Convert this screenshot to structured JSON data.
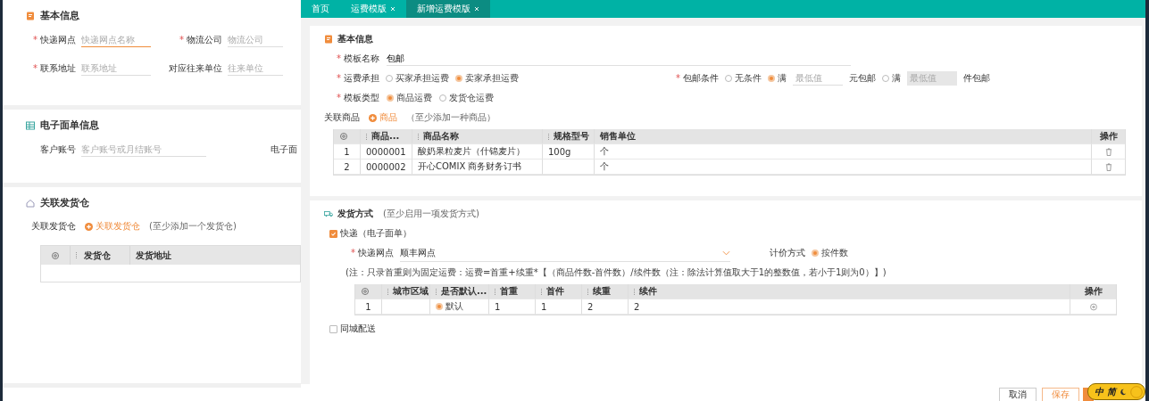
{
  "background_page": {
    "basic_info": {
      "title": "基本信息",
      "fields": [
        {
          "label": "快递网点",
          "required_mark": "*",
          "placeholder": "快递网点名称",
          "focused": true
        },
        {
          "label": "物流公司",
          "required_mark": "*",
          "placeholder": "物流公司",
          "focused": false
        },
        {
          "label": "联系地址",
          "required_mark": "*",
          "placeholder": "联系地址",
          "focused": false
        },
        {
          "label": "对应往来单位",
          "placeholder": "往来单位",
          "focused": false
        }
      ]
    },
    "e_waybill": {
      "title": "电子面单信息",
      "account": {
        "label": "客户账号",
        "placeholder": "客户账号或月结账号"
      },
      "column_2_label": "电子面"
    },
    "warehouse": {
      "title": "关联发货仓",
      "label": "关联发货仓",
      "add_button": "关联发货仓",
      "hint": "(至少添加一个发货仓)",
      "columns": [
        {
          "label": "发货仓",
          "sortable": true
        },
        {
          "label": "发货地址",
          "sortable": false
        }
      ]
    }
  },
  "tabs": [
    {
      "label": "首页",
      "closable": false,
      "selected": false
    },
    {
      "label": "运费模版",
      "closable": true,
      "selected": false
    },
    {
      "label": "新增运费模版",
      "closable": true,
      "selected": true
    }
  ],
  "basic": {
    "title": "基本信息",
    "template_name": {
      "label": "模板名称",
      "required_mark": "*",
      "value": "包邮"
    },
    "freight_bearer": {
      "label": "运费承担",
      "required_mark": "*",
      "options": [
        {
          "label": "买家承担运费",
          "selected": false
        },
        {
          "label": "卖家承担运费",
          "selected": true
        }
      ]
    },
    "free_shipping": {
      "label": "包邮条件",
      "required_mark": "*",
      "options": [
        {
          "label": "无条件",
          "selected": false
        },
        {
          "label": "满",
          "selected": true,
          "placeholder": "最低值",
          "suffix": "元包邮",
          "disabled": false
        },
        {
          "label": "满",
          "selected": false,
          "placeholder": "最低值",
          "suffix": "件包邮",
          "disabled": true
        }
      ]
    },
    "template_type": {
      "label": "模板类型",
      "required_mark": "*",
      "options": [
        {
          "label": "商品运费",
          "selected": true
        },
        {
          "label": "发货仓运费",
          "selected": false
        }
      ]
    },
    "related_goods": {
      "label": "关联商品",
      "add_button": "商品",
      "hint": "（至少添加一种商品）"
    },
    "goods_table": {
      "columns": [
        {
          "label": "商品...",
          "sortable": true
        },
        {
          "label": "商品名称",
          "sortable": true
        },
        {
          "label": "规格型号",
          "sortable": true
        },
        {
          "label": "销售单位",
          "sortable": false
        },
        {
          "label": "操作",
          "sortable": false
        }
      ],
      "rows": [
        {
          "index": "1",
          "code": "0000001",
          "name": "酸奶果粒麦片（什锦麦片）",
          "spec": "100g",
          "unit": "个"
        },
        {
          "index": "2",
          "code": "0000002",
          "name": "开心COMIX 商务财务订书",
          "unit": "个"
        }
      ]
    }
  },
  "shipping": {
    "title": "发货方式",
    "hint": "(至少启用一项发货方式)",
    "express": {
      "label": "快递（电子面单）",
      "checked": true
    },
    "outlet": {
      "label": "快递网点",
      "required_mark": "*",
      "value": "顺丰网点"
    },
    "pricing": {
      "label": "计价方式",
      "option": {
        "label": "按件数",
        "selected": true
      }
    },
    "note": "(注：只录首重则为固定运费：运费=首重+续重*【（商品件数-首件数）/续件数（注：除法计算值取大于1的整数值，若小于1则为0）】)",
    "table": {
      "columns": [
        {
          "label": "城市区域",
          "sortable": true
        },
        {
          "label": "是否默认...",
          "sortable": true
        },
        {
          "label": "首重",
          "sortable": true
        },
        {
          "label": "首件",
          "sortable": true
        },
        {
          "label": "续重",
          "sortable": true
        },
        {
          "label": "续件",
          "sortable": true
        },
        {
          "label": "操作",
          "sortable": false
        }
      ],
      "rows": [
        {
          "index": "1",
          "default": {
            "label": "默认",
            "selected": true
          },
          "first_weight": "1",
          "first_count": "1",
          "cont_weight": "2",
          "cont_count": "2"
        }
      ]
    },
    "same_city": {
      "label": "同城配送",
      "checked": false
    }
  },
  "footer": {
    "buttons": [
      {
        "label": "取消",
        "kind": "plain"
      },
      {
        "label": "保存",
        "kind": "outline"
      },
      {
        "kind": "primary"
      }
    ]
  },
  "ime": {
    "mode": "中",
    "charset": "简"
  }
}
